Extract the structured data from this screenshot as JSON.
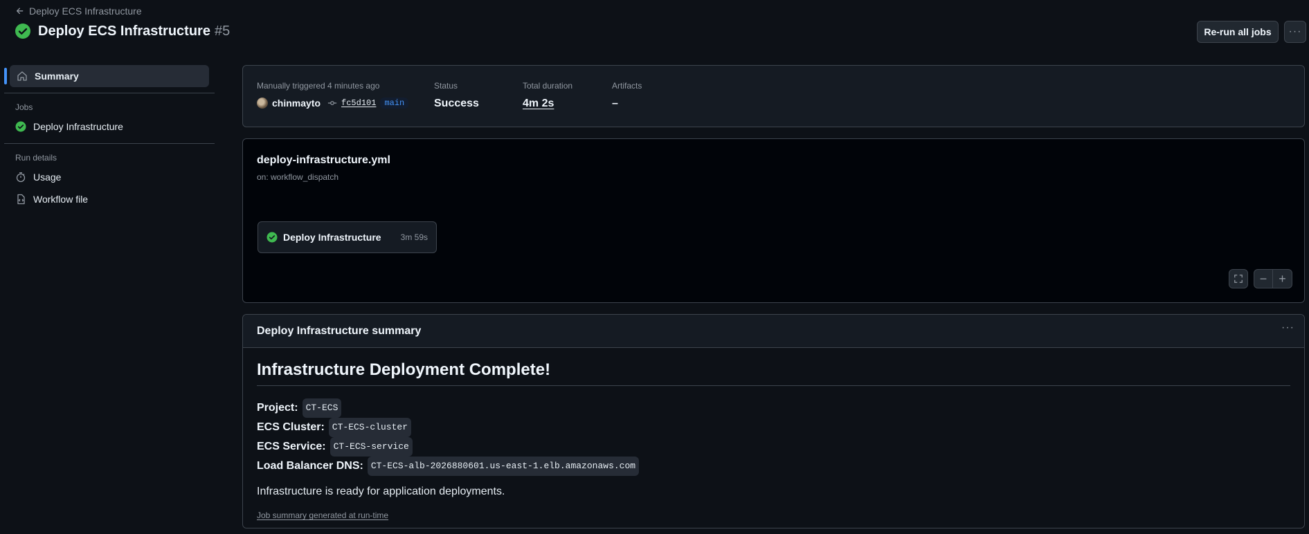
{
  "header": {
    "back_label": "Deploy ECS Infrastructure",
    "title": "Deploy ECS Infrastructure",
    "run_number": "#5",
    "rerun_label": "Re-run all jobs",
    "more_label": "···"
  },
  "sidebar": {
    "summary_label": "Summary",
    "jobs_heading": "Jobs",
    "job_label": "Deploy Infrastructure",
    "run_details_heading": "Run details",
    "usage_label": "Usage",
    "workflow_file_label": "Workflow file"
  },
  "meta": {
    "trigger_label": "Manually triggered 4 minutes ago",
    "user": "chinmayto",
    "commit_sha": "fc5d101",
    "branch": "main",
    "status_label": "Status",
    "status_value": "Success",
    "duration_label": "Total duration",
    "duration_value": "4m 2s",
    "artifacts_label": "Artifacts",
    "artifacts_value": "–"
  },
  "graph": {
    "workflow_file": "deploy-infrastructure.yml",
    "trigger": "on: workflow_dispatch",
    "job_name": "Deploy Infrastructure",
    "job_duration": "3m 59s",
    "zoom_out": "−",
    "zoom_in": "+"
  },
  "summary": {
    "title": "Deploy Infrastructure summary",
    "more_label": "···",
    "heading": "Infrastructure Deployment Complete!",
    "items": [
      {
        "key": "Project:",
        "value": "CT-ECS"
      },
      {
        "key": "ECS Cluster:",
        "value": "CT-ECS-cluster"
      },
      {
        "key": "ECS Service:",
        "value": "CT-ECS-service"
      },
      {
        "key": "Load Balancer DNS:",
        "value": "CT-ECS-alb-2026880601.us-east-1.elb.amazonaws.com"
      }
    ],
    "message": "Infrastructure is ready for application deployments.",
    "footer": "Job summary generated at run-time"
  },
  "colors": {
    "success": "#3fb950",
    "accent": "#4493f8",
    "background": "#0d1117"
  },
  "icons": {
    "back": "arrow-left-icon",
    "status": "check-circle-fill-icon",
    "summary": "home-icon",
    "usage": "stopwatch-icon",
    "workflow_file": "file-code-icon",
    "commit": "git-commit-icon",
    "fullscreen": "screen-full-icon"
  }
}
